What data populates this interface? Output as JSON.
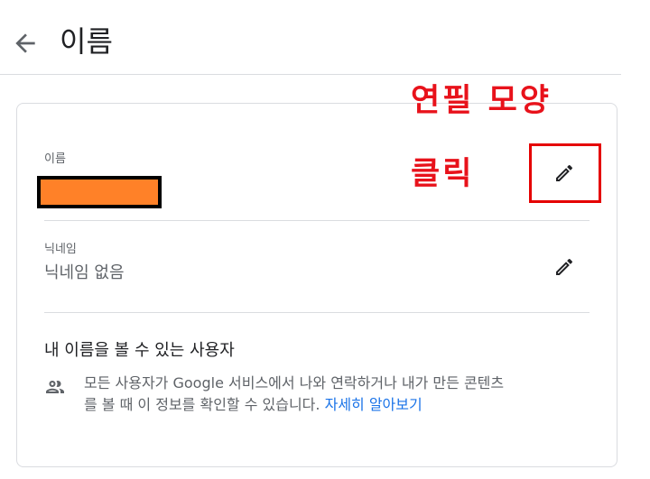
{
  "header": {
    "back_icon": "arrow-back-icon",
    "title": "이름"
  },
  "name_field": {
    "label": "이름",
    "value_redacted": true,
    "redaction_color": "#ff8128",
    "edit_icon": "pencil-icon"
  },
  "nickname_field": {
    "label": "닉네임",
    "value": "닉네임 없음",
    "edit_icon": "pencil-icon"
  },
  "visibility": {
    "title": "내 이름을 볼 수 있는 사용자",
    "icon": "people-icon",
    "description": "모든 사용자가 Google 서비스에서 나와 연락하거나 내가 만든 콘텐츠를 볼 때 이 정보를 확인할 수 있습니다.",
    "learn_more": "자세히 알아보기"
  },
  "annotation": {
    "line1": "연필 모양",
    "line2": "클릭",
    "color": "#e8121b"
  },
  "colors": {
    "link": "#1a73e8",
    "divider": "#dadce0",
    "annotation_box": "#e50000"
  }
}
